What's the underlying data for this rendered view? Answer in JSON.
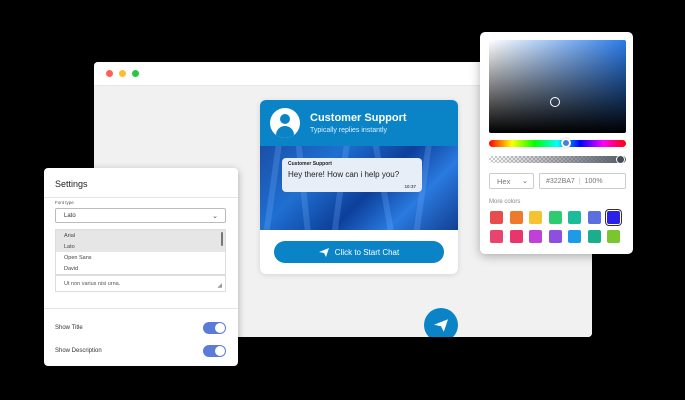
{
  "browser": {
    "chat_widget": {
      "title": "Customer Support",
      "subtitle": "Typically replies instantly",
      "message": {
        "sender": "Customer Support",
        "text": "Hey there! How can i help you?",
        "time": "10:37"
      },
      "start_button_label": "Click to Start Chat",
      "accent_color": "#0A84C6"
    }
  },
  "settings": {
    "title": "Settings",
    "font_type_label": "Font type",
    "font_type_value": "Lato",
    "font_options": [
      "Arial",
      "Lato",
      "Open Sans",
      "David"
    ],
    "textarea_text": "Ut non varius nisi urna.",
    "show_title": {
      "label": "Show Title",
      "on": true
    },
    "show_description": {
      "label": "Show Description",
      "on": true
    },
    "toggle_color": "#5B7BD8"
  },
  "color_picker": {
    "mode": "Hex",
    "hex_value": "#322BA7",
    "alpha": "100%",
    "more_colors_label": "More colors",
    "swatches": [
      "#E84C4C",
      "#F07A2C",
      "#F5C231",
      "#2ECC71",
      "#1ABC9C",
      "#5B6FE0",
      "#2B20E8",
      "#E8456E",
      "#E8356B",
      "#C23FD8",
      "#8E4FE0",
      "#1E9BE8",
      "#1AAE8C",
      "#7BC62D"
    ]
  }
}
